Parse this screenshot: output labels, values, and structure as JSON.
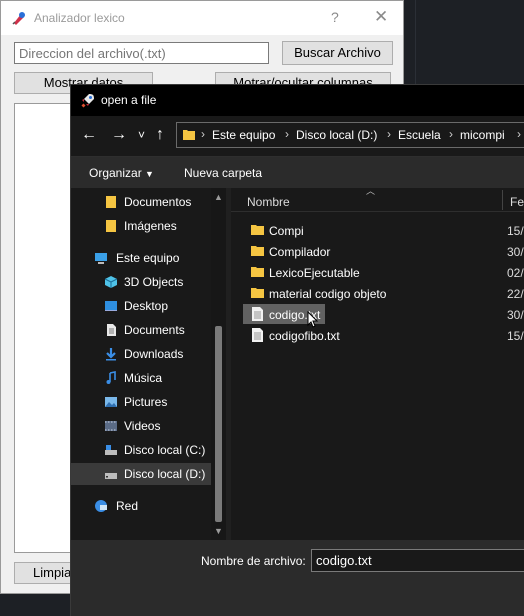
{
  "background_window": {
    "title": "Analizador lexico",
    "help_glyph": "?",
    "close_glyph": "✕",
    "path_placeholder": "Direccion del archivo(.txt)",
    "browse_label": "Buscar Archivo",
    "show_data_label": "Mostrar datos",
    "toggle_columns_label": "Motrar/ocultar columnas",
    "clear_label": "Limpia"
  },
  "dialog": {
    "title": "open a file",
    "nav": {
      "back": "←",
      "forward": "→",
      "recent": "˅",
      "up": "↑"
    },
    "breadcrumb": [
      "Este equipo",
      "Disco local (D:)",
      "Escuela",
      "micompi"
    ],
    "breadcrumb_sep": "›",
    "commands": {
      "organize": "Organizar",
      "new_folder": "Nueva carpeta"
    },
    "sidebar": [
      {
        "label": "Documentos",
        "icon": "folder-icon"
      },
      {
        "label": "Imágenes",
        "icon": "folder-icon"
      },
      {
        "label": "Este equipo",
        "icon": "computer-icon"
      },
      {
        "label": "3D Objects",
        "icon": "cube-icon"
      },
      {
        "label": "Desktop",
        "icon": "desktop-icon"
      },
      {
        "label": "Documents",
        "icon": "document-icon"
      },
      {
        "label": "Downloads",
        "icon": "download-icon"
      },
      {
        "label": "Música",
        "icon": "music-icon"
      },
      {
        "label": "Pictures",
        "icon": "pictures-icon"
      },
      {
        "label": "Videos",
        "icon": "video-icon"
      },
      {
        "label": "Disco local (C:)",
        "icon": "drive-icon"
      },
      {
        "label": "Disco local (D:)",
        "icon": "drive-icon"
      },
      {
        "label": "Red",
        "icon": "network-icon"
      }
    ],
    "columns": {
      "name": "Nombre",
      "date": "Fec"
    },
    "files": [
      {
        "name": "Compi",
        "date": "15/",
        "type": "folder"
      },
      {
        "name": "Compilador",
        "date": "30/",
        "type": "folder"
      },
      {
        "name": "LexicoEjecutable",
        "date": "02/",
        "type": "folder"
      },
      {
        "name": "material codigo objeto",
        "date": "22/",
        "type": "folder"
      },
      {
        "name": "codigo.txt",
        "date": "30/",
        "type": "file"
      },
      {
        "name": "codigofibo.txt",
        "date": "15/",
        "type": "file"
      }
    ],
    "filename_label": "Nombre de archivo:",
    "filename_value": "codigo.txt"
  },
  "colors": {
    "folder_yellow": "#f5c542",
    "dialog_bg": "#191919",
    "selection": "#626262"
  }
}
